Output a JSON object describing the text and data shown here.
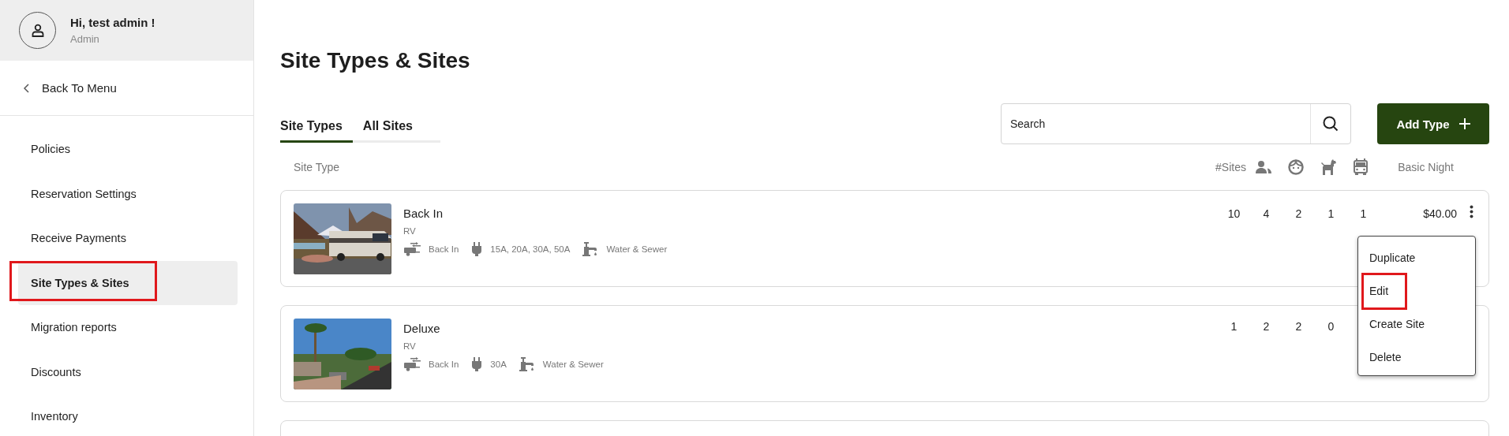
{
  "user": {
    "greeting": "Hi, test admin !",
    "role": "Admin"
  },
  "back_link": {
    "label": "Back To Menu"
  },
  "sidebar": {
    "items": [
      {
        "label": "Policies",
        "selected": false,
        "highlighted": false
      },
      {
        "label": "Reservation Settings",
        "selected": false,
        "highlighted": false
      },
      {
        "label": "Receive Payments",
        "selected": false,
        "highlighted": false
      },
      {
        "label": "Site Types & Sites",
        "selected": true,
        "highlighted": true
      },
      {
        "label": "Migration reports",
        "selected": false,
        "highlighted": false
      },
      {
        "label": "Discounts",
        "selected": false,
        "highlighted": false
      },
      {
        "label": "Inventory",
        "selected": false,
        "highlighted": false
      }
    ]
  },
  "page": {
    "title": "Site Types & Sites"
  },
  "tabs": [
    {
      "label": "Site Types",
      "selected": true
    },
    {
      "label": "All Sites",
      "selected": false
    }
  ],
  "search": {
    "placeholder": "Search"
  },
  "add_button": {
    "label": "Add Type"
  },
  "table": {
    "site_type_label": "Site Type",
    "sites_label": "#Sites",
    "price_label": "Basic Night",
    "rows": [
      {
        "name": "Back In",
        "category": "RV",
        "features": [
          {
            "kind": "parking",
            "text": "Back In"
          },
          {
            "kind": "power",
            "text": "15A, 20A, 30A, 50A"
          },
          {
            "kind": "utilities",
            "text": "Water & Sewer"
          }
        ],
        "counts": [
          "10",
          "4",
          "2",
          "1",
          "1"
        ],
        "price": "$40.00",
        "actions_visible": true,
        "menu_open": true
      },
      {
        "name": "Deluxe",
        "category": "RV",
        "features": [
          {
            "kind": "parking",
            "text": "Back In"
          },
          {
            "kind": "power",
            "text": "30A"
          },
          {
            "kind": "utilities",
            "text": "Water & Sewer"
          }
        ],
        "counts": [
          "1",
          "2",
          "2",
          "0"
        ],
        "actions_visible": false,
        "menu_open": false
      }
    ]
  },
  "context_menu": {
    "items": [
      {
        "label": "Duplicate",
        "highlighted": false
      },
      {
        "label": "Edit",
        "highlighted": true
      },
      {
        "label": "Create Site",
        "highlighted": false
      },
      {
        "label": "Delete",
        "highlighted": false
      }
    ]
  }
}
